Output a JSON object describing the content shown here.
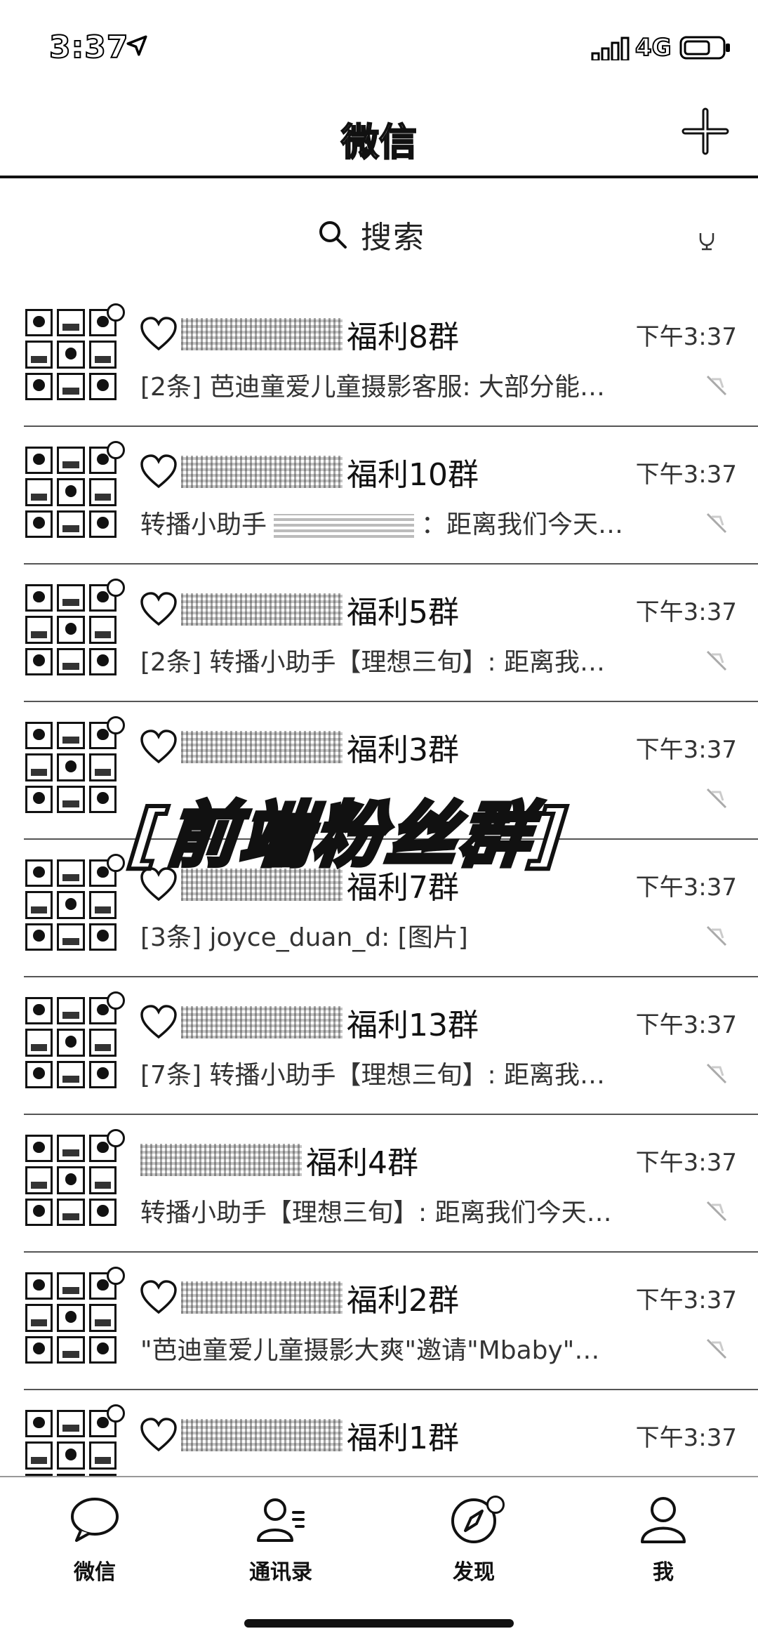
{
  "status_bar": {
    "time": "3:37",
    "network": "4G"
  },
  "nav": {
    "title": "微信",
    "icon": "plus-icon"
  },
  "search": {
    "placeholder": "搜索"
  },
  "banner": {
    "text": "[前端粉丝群]"
  },
  "chats": [
    {
      "title_suffix": "福利8群",
      "time": "下午3:37",
      "message": "[2条] 芭迪童爱儿童摄影客服: 大部分能…",
      "heart": true
    },
    {
      "title_suffix": "福利10群",
      "time": "下午3:37",
      "message_prefix": "转播小助手",
      "message": "：距离我们今天…",
      "heart": true
    },
    {
      "title_suffix": "福利5群",
      "time": "下午3:37",
      "message": "[2条] 转播小助手【理想三旬】: 距离我…",
      "heart": true
    },
    {
      "title_suffix": "福利3群",
      "time": "下午3:37",
      "message": "",
      "heart": true
    },
    {
      "title_suffix": "福利7群",
      "time": "下午3:37",
      "message": "[3条] joyce_duan_d: [图片]",
      "heart": true
    },
    {
      "title_suffix": "福利13群",
      "time": "下午3:37",
      "message": "[7条] 转播小助手【理想三旬】: 距离我…",
      "heart": true
    },
    {
      "title_suffix": "福利4群",
      "time": "下午3:37",
      "message": "转播小助手【理想三旬】: 距离我们今天…",
      "heart": false
    },
    {
      "title_suffix": "福利2群",
      "time": "下午3:37",
      "message": "\"芭迪童爱儿童摄影大爽\"邀请\"Mbaby\"…",
      "heart": true
    },
    {
      "title_suffix": "福利1群",
      "time": "下午3:37",
      "message": "",
      "heart": true
    }
  ],
  "tabs": [
    {
      "label": "微信",
      "icon": "chat-bubble-icon"
    },
    {
      "label": "通讯录",
      "icon": "contacts-icon"
    },
    {
      "label": "发现",
      "icon": "compass-icon"
    },
    {
      "label": "我",
      "icon": "person-icon"
    }
  ]
}
